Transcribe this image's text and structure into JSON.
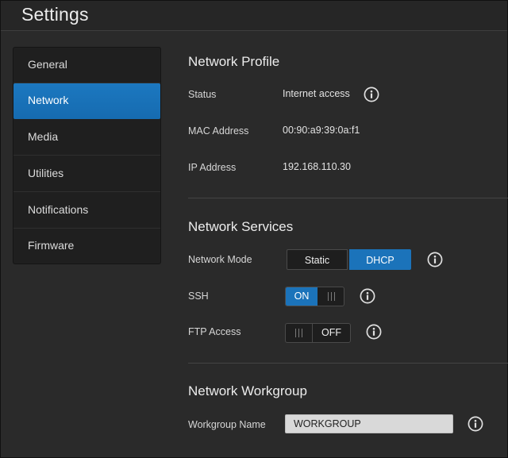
{
  "header": {
    "title": "Settings"
  },
  "sidebar": {
    "items": [
      {
        "label": "General"
      },
      {
        "label": "Network"
      },
      {
        "label": "Media"
      },
      {
        "label": "Utilities"
      },
      {
        "label": "Notifications"
      },
      {
        "label": "Firmware"
      }
    ],
    "active": "Network"
  },
  "network_profile": {
    "title": "Network Profile",
    "status_label": "Status",
    "status_value": "Internet access",
    "mac_label": "MAC Address",
    "mac_value": "00:90:a9:39:0a:f1",
    "ip_label": "IP Address",
    "ip_value": "192.168.110.30"
  },
  "network_services": {
    "title": "Network Services",
    "mode_label": "Network Mode",
    "mode_options": [
      "Static",
      "DHCP"
    ],
    "mode_selected": "DHCP",
    "ssh_label": "SSH",
    "ssh_state": "ON",
    "ftp_label": "FTP Access",
    "ftp_state": "OFF"
  },
  "network_workgroup": {
    "title": "Network Workgroup",
    "workgroup_label": "Workgroup Name",
    "workgroup_value": "WORKGROUP"
  },
  "icons": {
    "info": "info-icon",
    "toggle_grip": "grip-lines-icon"
  },
  "colors": {
    "accent": "#1b73ba",
    "background": "#2a2a2a",
    "sidebar_bg": "#1f1f1f",
    "input_bg": "#d9d9d9"
  }
}
